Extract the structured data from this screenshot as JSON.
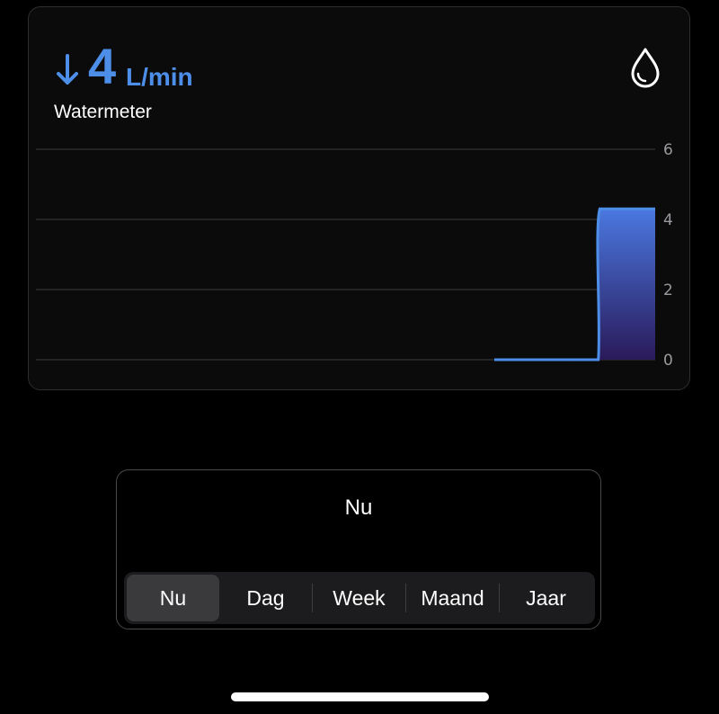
{
  "card": {
    "value": "4",
    "unit": "L/min",
    "name": "Watermeter",
    "icons": {
      "trend": "arrow-down-icon",
      "type": "water-drop-icon"
    },
    "accent_color": "#4d8fe8"
  },
  "chart_data": {
    "type": "area",
    "x": [
      0,
      1,
      2,
      3,
      4,
      5,
      6,
      7,
      8,
      9,
      10,
      11,
      12,
      13,
      14
    ],
    "values": [
      0,
      0,
      0,
      0,
      0,
      0,
      0,
      0,
      0,
      0,
      4.3,
      4.3,
      4.3,
      4.3,
      4.3
    ],
    "ylim": [
      0,
      6
    ],
    "yticks": [
      "0",
      "2",
      "4",
      "6"
    ],
    "grid": true,
    "line_color": "#4d8fe8",
    "fill_top_color": "#4a78e0",
    "fill_bottom_color": "#2a1a5a"
  },
  "selector": {
    "title": "Nu",
    "options": [
      {
        "label": "Nu",
        "active": true
      },
      {
        "label": "Dag",
        "active": false
      },
      {
        "label": "Week",
        "active": false
      },
      {
        "label": "Maand",
        "active": false
      },
      {
        "label": "Jaar",
        "active": false
      }
    ]
  }
}
